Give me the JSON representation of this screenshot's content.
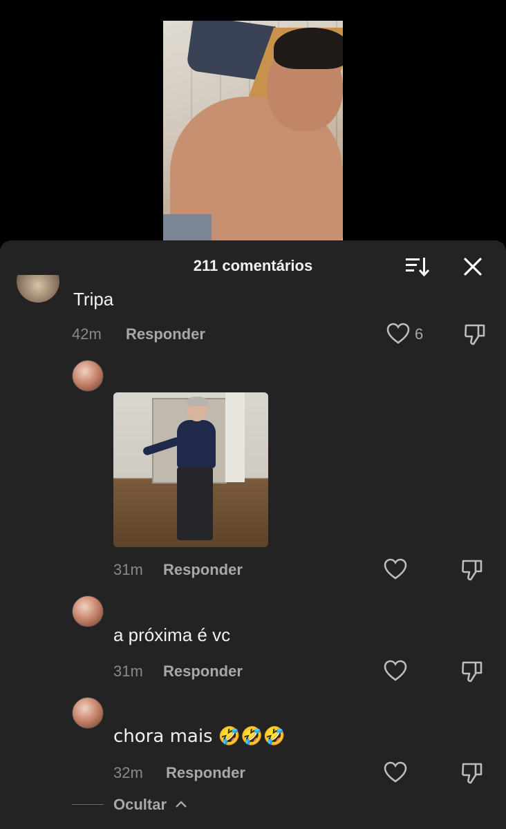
{
  "header": {
    "comment_count": "211 comentários"
  },
  "comments": [
    {
      "text": "Tripa",
      "time": "42m",
      "reply_label": "Responder",
      "likes": "6"
    },
    {
      "text": "",
      "time": "31m",
      "reply_label": "Responder",
      "attachment": "gif"
    },
    {
      "text": "a próxima é vc",
      "time": "31m",
      "reply_label": "Responder"
    },
    {
      "text": "chora mais 🤣🤣🤣",
      "time": "32m",
      "reply_label": "Responder"
    }
  ],
  "footer": {
    "hide_label": "Ocultar"
  },
  "icons": {
    "sort": "sort-icon",
    "close": "close-icon",
    "like": "heart-icon",
    "dislike": "dislike-icon",
    "collapse": "chevron-up-icon"
  },
  "colors": {
    "sheet_background": "#232323",
    "secondary_text": "#8a8a8a",
    "primary_text": "#f1f1f1"
  }
}
